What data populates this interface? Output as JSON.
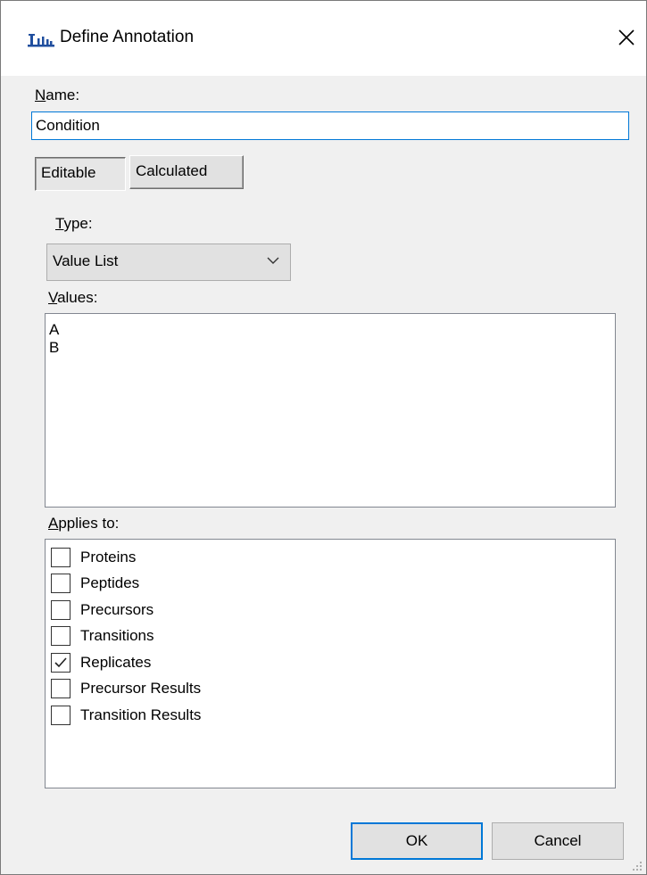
{
  "window": {
    "title": "Define Annotation",
    "close_glyph": "✕",
    "icon": "app-icon"
  },
  "name": {
    "label": "Name:",
    "value": "Condition"
  },
  "mode_toggles": [
    {
      "label": "Editable",
      "pressed": true
    },
    {
      "label": "Calculated",
      "pressed": false
    }
  ],
  "type": {
    "label": "Type:",
    "selected": "Value List"
  },
  "values": {
    "label": "Values:",
    "items": [
      "A",
      "B"
    ]
  },
  "applies_to": {
    "label": "Applies to:",
    "items": [
      {
        "label": "Proteins",
        "checked": false
      },
      {
        "label": "Peptides",
        "checked": false
      },
      {
        "label": "Precursors",
        "checked": false
      },
      {
        "label": "Transitions",
        "checked": false
      },
      {
        "label": "Replicates",
        "checked": true
      },
      {
        "label": "Precursor Results",
        "checked": false
      },
      {
        "label": "Transition Results",
        "checked": false
      }
    ]
  },
  "buttons": {
    "ok": "OK",
    "cancel": "Cancel"
  },
  "colors": {
    "focus_accent": "#0078d7",
    "window_bg": "#f0f0f0",
    "icon_blue": "#1f4e9e"
  }
}
